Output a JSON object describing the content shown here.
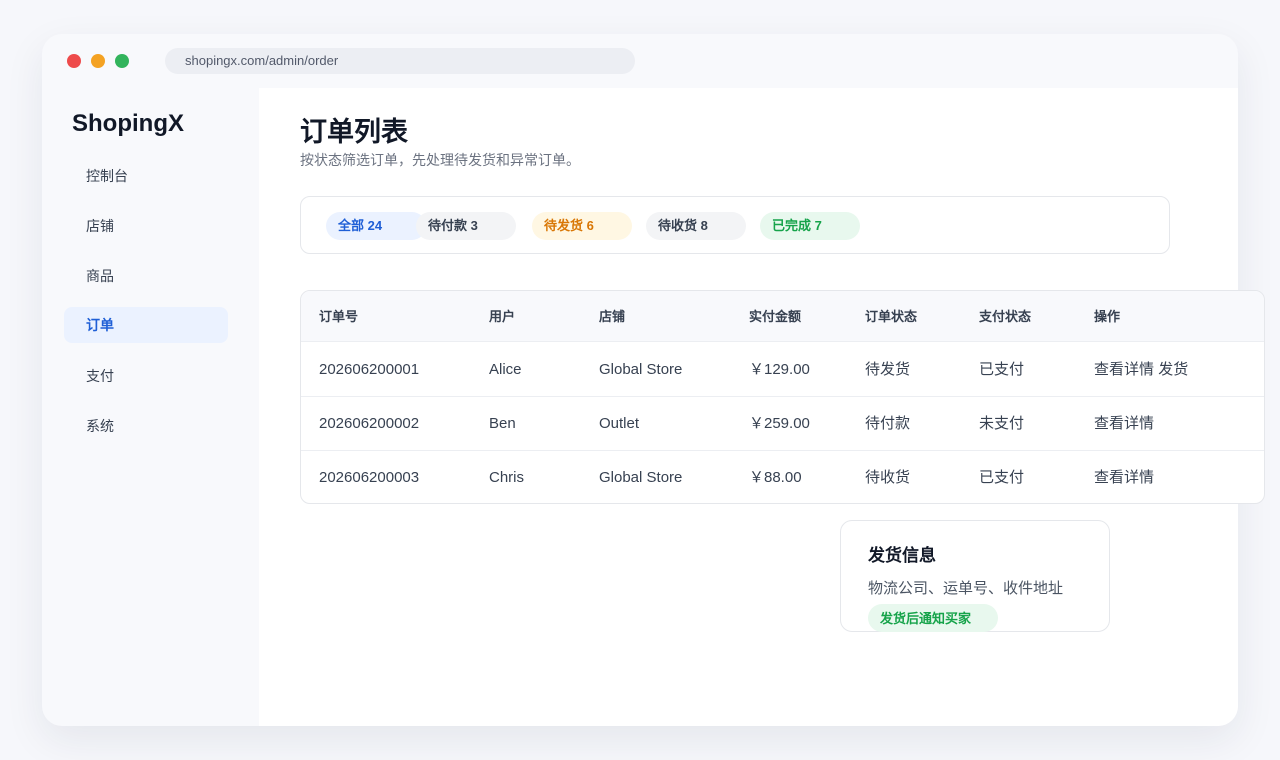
{
  "browser": {
    "url": "shopingx.com/admin/order"
  },
  "sidebar": {
    "brand": "ShopingX",
    "items": [
      {
        "label": "控制台"
      },
      {
        "label": "店铺"
      },
      {
        "label": "商品"
      },
      {
        "label": "订单"
      },
      {
        "label": "支付"
      },
      {
        "label": "系统"
      }
    ]
  },
  "page": {
    "title": "订单列表",
    "subtitle": "按状态筛选订单，先处理待发货和异常订单。"
  },
  "filters": [
    {
      "label": "全部 24"
    },
    {
      "label": "待付款 3"
    },
    {
      "label": "待发货 6"
    },
    {
      "label": "待收货 8"
    },
    {
      "label": "已完成 7"
    }
  ],
  "table": {
    "headers": [
      "订单号",
      "用户",
      "店铺",
      "实付金额",
      "订单状态",
      "支付状态",
      "操作"
    ],
    "rows": [
      {
        "order_no": "202606200001",
        "user": "Alice",
        "store": "Global Store",
        "amount": "￥129.00",
        "order_status": "待发货",
        "pay_status": "已支付",
        "action_view": "查看详情",
        "action_ship": "发货"
      },
      {
        "order_no": "202606200002",
        "user": "Ben",
        "store": "Outlet",
        "amount": "￥259.00",
        "order_status": "待付款",
        "pay_status": "未支付",
        "action_view": "查看详情"
      },
      {
        "order_no": "202606200003",
        "user": "Chris",
        "store": "Global Store",
        "amount": "￥88.00",
        "order_status": "待收货",
        "pay_status": "已支付",
        "action_view": "查看详情"
      }
    ]
  },
  "shipping": {
    "title": "发货信息",
    "desc": "物流公司、运单号、收件地址",
    "badge": "发货后通知买家"
  },
  "colors": {
    "accent": "#1f5fd6",
    "warning": "#d97706",
    "success": "#16a34a"
  }
}
